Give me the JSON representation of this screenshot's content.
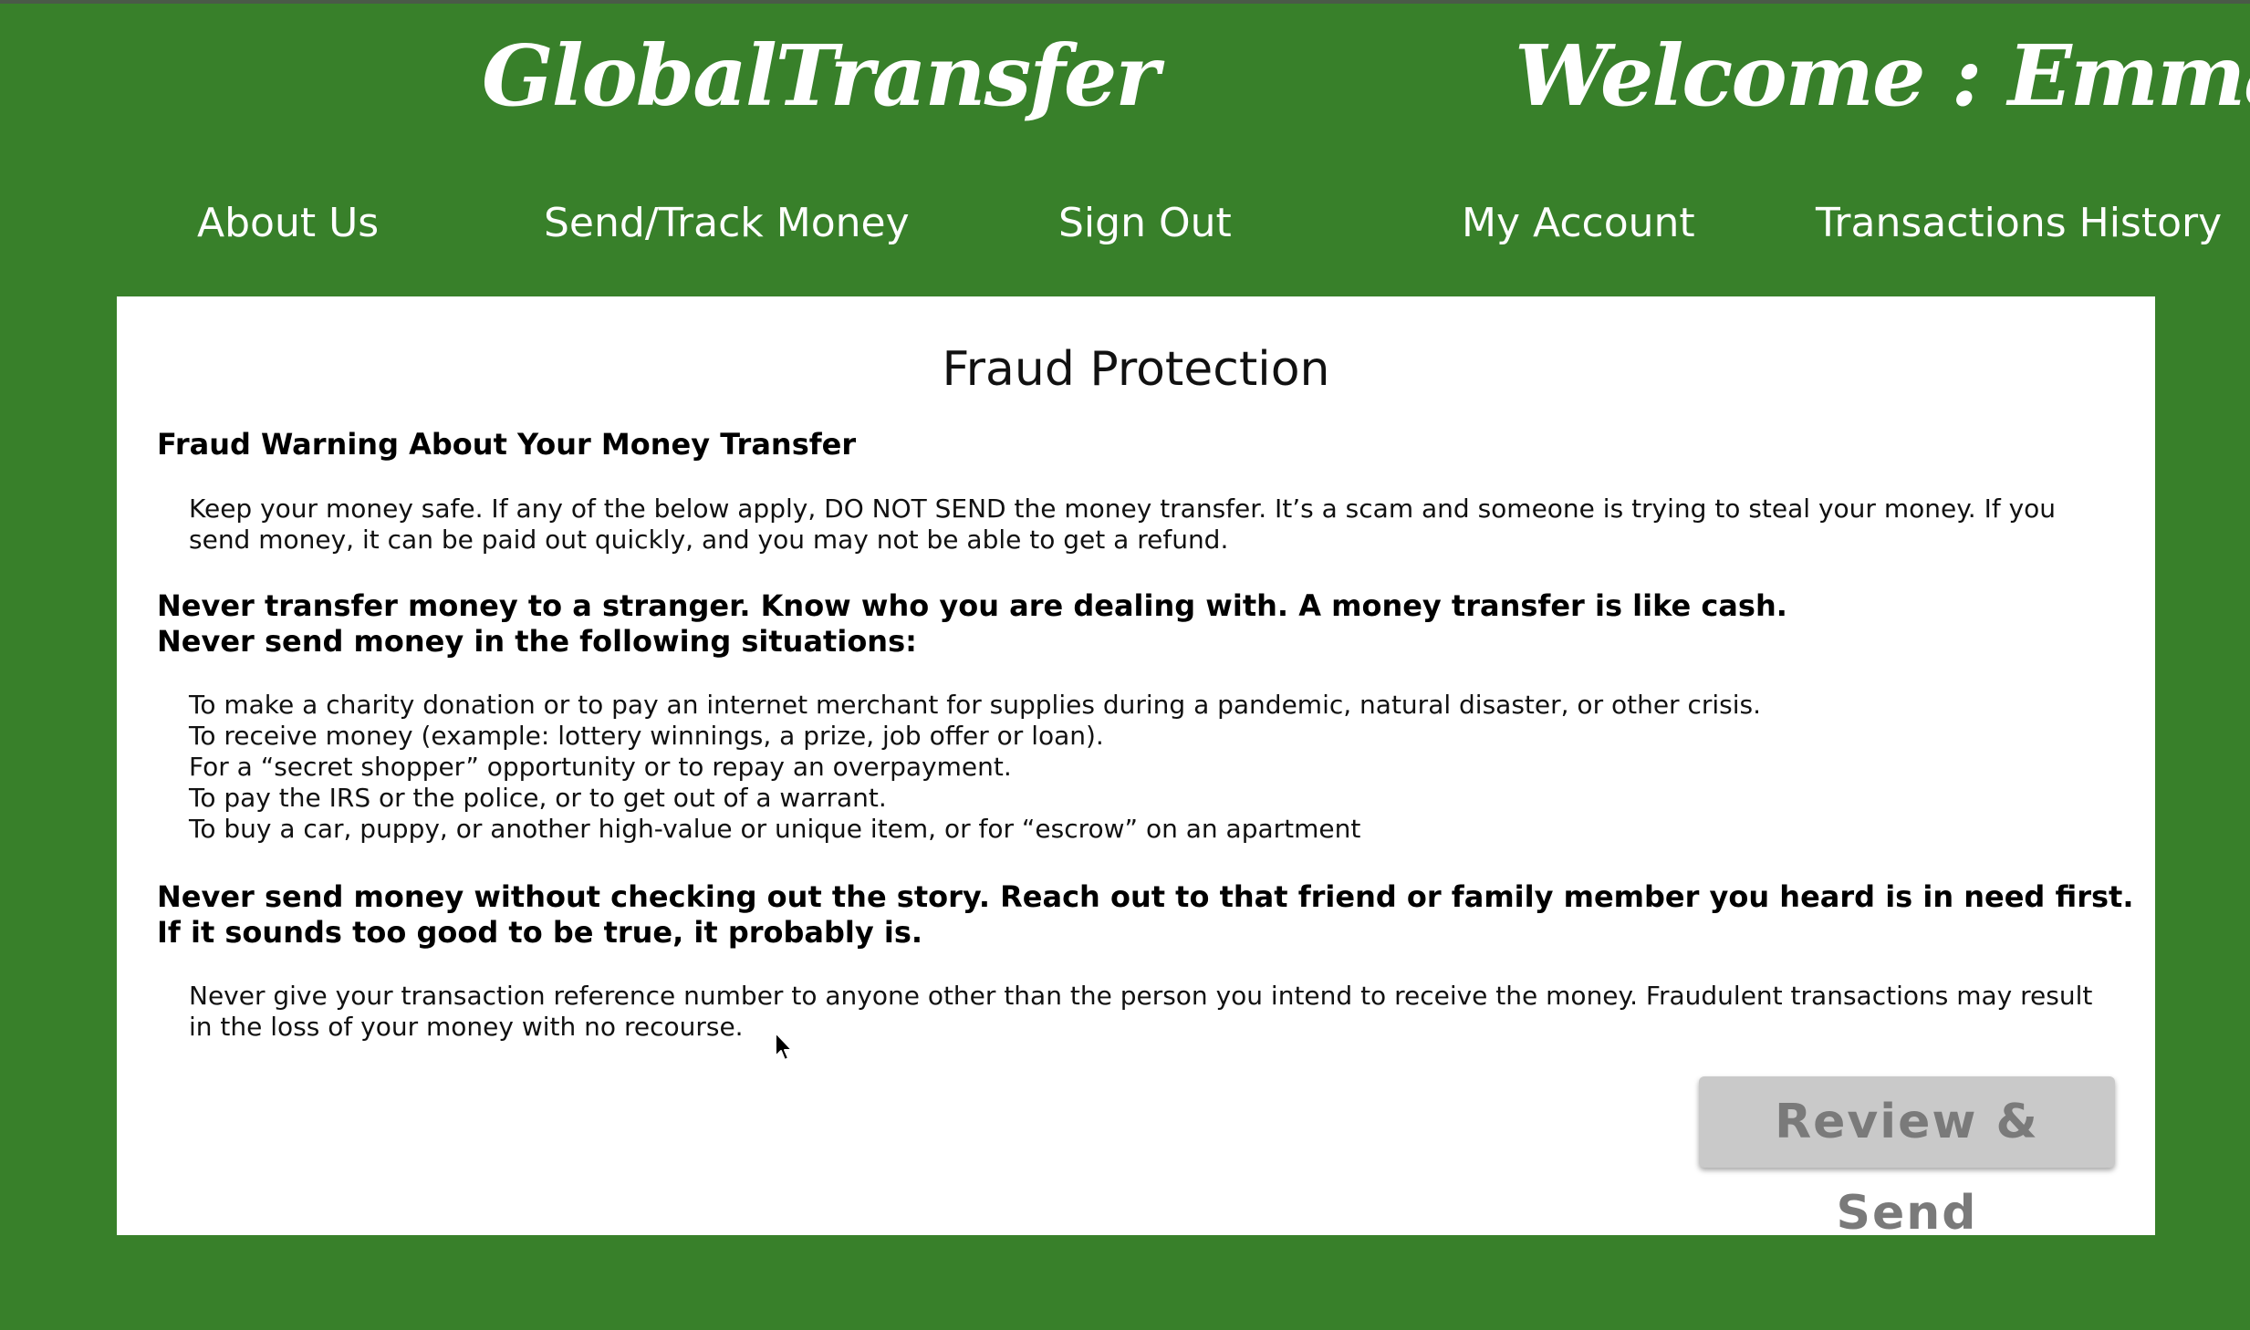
{
  "header": {
    "brand": "GlobalTransfer",
    "welcome": "Welcome : Emma"
  },
  "nav": {
    "about": "About Us",
    "send_track": "Send/Track Money",
    "sign_out": "Sign Out",
    "my_account": "My Account",
    "history": "Transactions History"
  },
  "main": {
    "title": "Fraud Protection",
    "warning_heading": "Fraud Warning About Your Money Transfer",
    "intro_paragraph": "Keep your money safe. If any of the below apply, DO NOT SEND the money transfer. It’s a scam and someone is trying to steal your money. If you send money, it can be paid out quickly, and you may not be able to get a refund.",
    "never_stranger": "Never transfer money to a stranger. Know who you are dealing with. A money transfer is like cash.",
    "never_situations": "Never send money in the following situations:",
    "situations": [
      "To make a charity donation or to pay an internet merchant for supplies during a pandemic, natural disaster, or other crisis.",
      "To receive money (example: lottery winnings, a prize, job offer or loan).",
      "For a “secret shopper” opportunity or to repay an overpayment.",
      "To pay the IRS or the police, or to get out of a warrant.",
      "To buy a car, puppy, or another high-value or unique item, or for “escrow” on an apartment"
    ],
    "never_without_checking": "Never send money without checking out the story. Reach out to that friend or family member you heard is in need first.",
    "too_good": "If it sounds too good to be true, it probably is.",
    "reference_paragraph": "Never give your transaction reference number to anyone other than the person you intend to receive the money. Fraudulent transactions may result in the loss of your money with no recourse.",
    "review_send_button": "Review & Send"
  },
  "colors": {
    "background": "#38802a",
    "panel": "#ffffff",
    "button_disabled": "#c9c9c9",
    "button_text": "#7a7a7a"
  },
  "icons": {
    "cursor": "mouse-pointer-icon"
  }
}
